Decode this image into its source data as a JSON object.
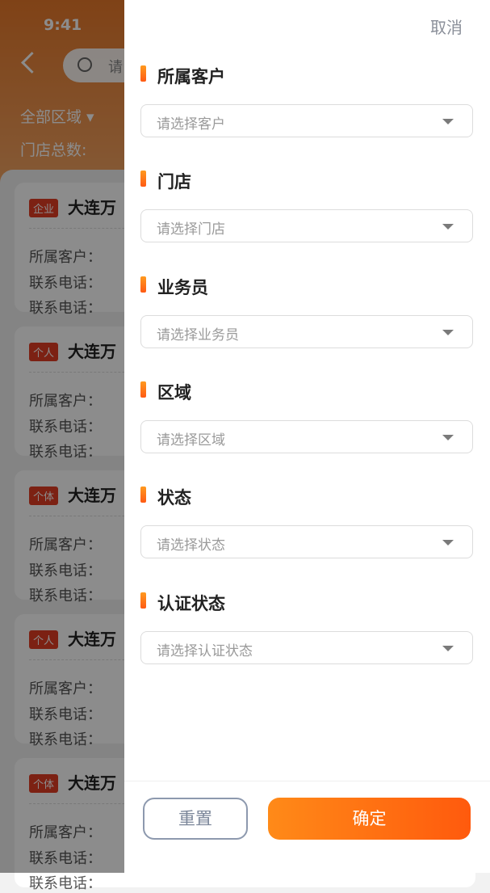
{
  "status_bar": {
    "time": "9:41"
  },
  "background": {
    "search_placeholder": "请",
    "area_filter": "全部区域 ▾",
    "store_total": "门店总数:",
    "cards": [
      {
        "tag": "企业",
        "name": "大连万",
        "rows": [
          "所属客户：",
          "联系电话：",
          "联系电话："
        ]
      },
      {
        "tag": "个人",
        "name": "大连万",
        "rows": [
          "所属客户：",
          "联系电话：",
          "联系电话："
        ]
      },
      {
        "tag": "个体",
        "name": "大连万",
        "rows": [
          "所属客户：",
          "联系电话：",
          "联系电话："
        ]
      },
      {
        "tag": "个人",
        "name": "大连万",
        "rows": [
          "所属客户：",
          "联系电话：",
          "联系电话："
        ]
      },
      {
        "tag": "个体",
        "name": "大连万",
        "rows": [
          "所属客户：",
          "联系电话：",
          "联系电话："
        ]
      }
    ]
  },
  "drawer": {
    "cancel_label": "取消",
    "sections": [
      {
        "title": "所属客户",
        "placeholder": "请选择客户"
      },
      {
        "title": "门店",
        "placeholder": "请选择门店"
      },
      {
        "title": "业务员",
        "placeholder": "请选择业务员"
      },
      {
        "title": "区域",
        "placeholder": "请选择区域"
      },
      {
        "title": "状态",
        "placeholder": "请选择状态"
      },
      {
        "title": "认证状态",
        "placeholder": "请选择认证状态"
      }
    ],
    "reset_label": "重置",
    "confirm_label": "确定"
  },
  "colors": {
    "accent": "#ff6a14",
    "header": "#e8792a",
    "tag": "#e23c24"
  }
}
